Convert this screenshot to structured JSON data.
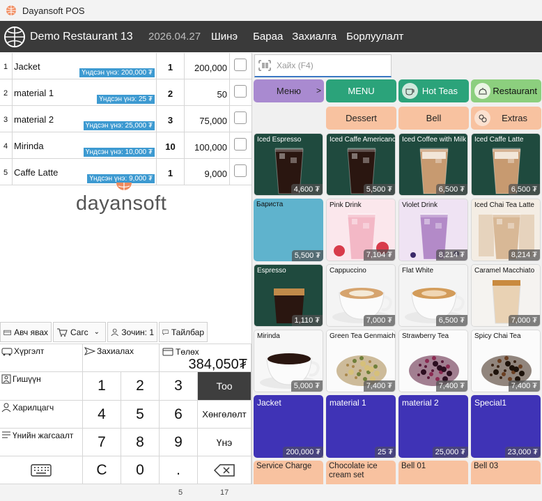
{
  "window": {
    "title": "Dayansoft POS"
  },
  "header": {
    "restaurant": "Demo Restaurant 13",
    "date": "2026.04.27",
    "nav": [
      "Шинэ",
      "Бараа",
      "Захиалга",
      "Борлуулалт"
    ]
  },
  "orders": [
    {
      "idx": "1",
      "name": "Jacket",
      "base_price": "Үндсэн үнэ: 200,000 ₮",
      "qty": "1",
      "amount": "200,000"
    },
    {
      "idx": "2",
      "name": "material 1",
      "base_price": "Үндсэн үнэ: 25 ₮",
      "qty": "2",
      "amount": "50"
    },
    {
      "idx": "3",
      "name": "material 2",
      "base_price": "Үндсэн үнэ: 25,000 ₮",
      "qty": "3",
      "amount": "75,000"
    },
    {
      "idx": "4",
      "name": "Mirinda",
      "base_price": "Үндсэн үнэ: 10,000 ₮",
      "qty": "10",
      "amount": "100,000"
    },
    {
      "idx": "5",
      "name": "Caffe Latte",
      "base_price": "Үндсэн үнэ: 9,000 ₮",
      "qty": "1",
      "amount": "9,000"
    }
  ],
  "watermark": "dayansoft",
  "actions": {
    "takeaway": "Авч явах",
    "cart": "Сагс",
    "guests": "Зочин: 1",
    "note": "Тайлбар"
  },
  "keypad": {
    "delivery": "Хүргэлт",
    "order": "Захиалах",
    "payment": "Төлөх",
    "total": "384,050₮",
    "member": "Гишүүн",
    "customer": "Харилцагч",
    "pricelist": "Үнийн жагсаалт",
    "keys": [
      "1",
      "2",
      "3",
      "4",
      "5",
      "6",
      "7",
      "8",
      "9",
      "C",
      "0",
      "."
    ],
    "qty": "Тоо",
    "discount": "Хөнгөлөлт",
    "price": "Үнэ"
  },
  "status": {
    "left": "5",
    "right": "17"
  },
  "search": {
    "placeholder": "Хайх (F4)"
  },
  "categories": {
    "menu_parent": "Меню",
    "menu": "MENU",
    "hot_teas": "Hot Teas",
    "restaurant": "Restaurant",
    "dessert": "Dessert",
    "bell": "Bell",
    "extras": "Extras"
  },
  "products": [
    {
      "name": "Iced Espresso",
      "price": "4,600 ₮",
      "art": "iced-dark"
    },
    {
      "name": "Iced Caffe Americano",
      "price": "5,500 ₮",
      "art": "iced-dark"
    },
    {
      "name": "Iced Coffee with Milk",
      "price": "6,500 ₮",
      "art": "iced-milk"
    },
    {
      "name": "Iced Caffe Latte",
      "price": "6,500 ₮",
      "art": "iced-milk"
    },
    {
      "name": "Бариста",
      "price": "5,500 ₮",
      "art": "plain-blue"
    },
    {
      "name": "Pink Drink",
      "price": "7,104 ₮",
      "art": "pink"
    },
    {
      "name": "Violet Drink",
      "price": "8,214 ₮",
      "art": "violet"
    },
    {
      "name": "Iced Chai Tea Latte",
      "price": "8,214 ₮",
      "art": "chai"
    },
    {
      "name": "Espresso",
      "price": "1,110 ₮",
      "art": "espresso"
    },
    {
      "name": "Cappuccino",
      "price": "7,000 ₮",
      "art": "cappuccino"
    },
    {
      "name": "Flat White",
      "price": "6,500 ₮",
      "art": "flatwhite"
    },
    {
      "name": "Caramel Macchiato",
      "price": "7,000 ₮",
      "art": "caramel"
    },
    {
      "name": "Mirinda",
      "price": "5,000 ₮",
      "art": "coffee-cup"
    },
    {
      "name": "Green Tea Genmaicha",
      "price": "7,400 ₮",
      "art": "tea-green"
    },
    {
      "name": "Strawberry Tea",
      "price": "7,400 ₮",
      "art": "tea-red"
    },
    {
      "name": "Spicy Chai Tea",
      "price": "7,400 ₮",
      "art": "tea-dark"
    }
  ],
  "materials": [
    {
      "name": "Jacket",
      "price": "200,000 ₮"
    },
    {
      "name": "material 1",
      "price": "25 ₮"
    },
    {
      "name": "material 2",
      "price": "25,000 ₮"
    },
    {
      "name": "Special1",
      "price": "23,000 ₮"
    }
  ],
  "extras_items": [
    "Service Charge",
    "Chocolate ice cream set",
    "Bell 01",
    "Bell 03"
  ],
  "colors": {
    "menu_parent": "#a98ad0",
    "green": "#2ba37a",
    "restaurant": "#8ccf7e",
    "peach": "#f8c2a0",
    "material": "#3f33b6",
    "barista": "#5fb3cd"
  }
}
